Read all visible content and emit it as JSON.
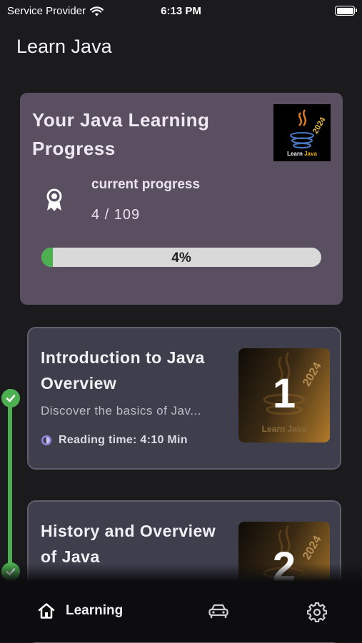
{
  "status_bar": {
    "carrier": "Service Provider",
    "time": "6:13 PM"
  },
  "app": {
    "title": "Learn Java"
  },
  "progress_card": {
    "title": "Your Java Learning Progress",
    "logo_text": "Learn ",
    "logo_text_accent": "Java",
    "logo_year": "2024",
    "current_label": "current progress",
    "current_value": "4 / 109",
    "percent_label": "4%",
    "percent": 4
  },
  "lessons": [
    {
      "title": "Introduction to Java Overview",
      "description": "Discover the basics of Jav...",
      "reading_time": "Reading time: 4:10 Min",
      "number": "1",
      "thumb_year": "2024",
      "thumb_brand": "Learn Java",
      "completed": true
    },
    {
      "title": "History and Overview of Java",
      "number": "2",
      "thumb_year": "2024",
      "completed": true
    }
  ],
  "bottom_nav": {
    "items": [
      {
        "label": "Learning",
        "icon": "home-icon",
        "active": true
      },
      {
        "label": "",
        "icon": "car-icon"
      },
      {
        "label": "",
        "icon": "gear-icon"
      }
    ]
  },
  "colors": {
    "accent_green": "#4caf50",
    "card_bg": "#5a4f61",
    "lesson_bg": "#3f3e4c",
    "background": "#1b1b1e"
  }
}
